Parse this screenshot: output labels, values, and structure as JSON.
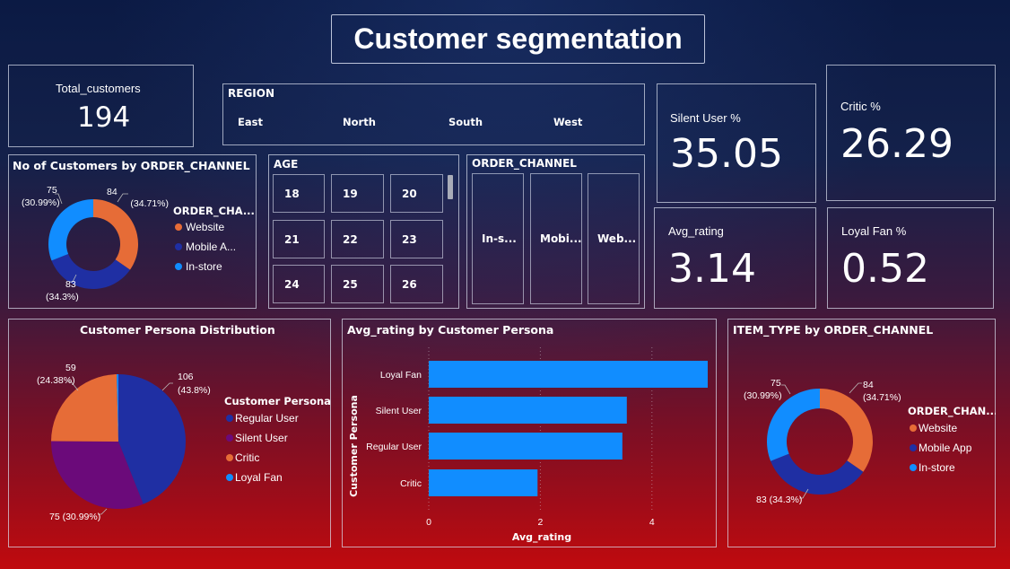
{
  "title": "Customer segmentation",
  "total_customers": {
    "label": "Total_customers",
    "value": "194"
  },
  "region": {
    "title": "REGION",
    "items": [
      "East",
      "North",
      "South",
      "West"
    ]
  },
  "silent_user": {
    "label": "Silent User %",
    "value": "35.05"
  },
  "critic": {
    "label": "Critic %",
    "value": "26.29"
  },
  "avg_rating_card": {
    "label": "Avg_rating",
    "value": "3.14"
  },
  "loyal_fan": {
    "label": "Loyal Fan %",
    "value": "0.52"
  },
  "age": {
    "title": "AGE",
    "items": [
      "18",
      "19",
      "20",
      "21",
      "22",
      "23",
      "24",
      "25",
      "26"
    ]
  },
  "order_channel_slicer": {
    "title": "ORDER_CHANNEL",
    "items": [
      "In-s...",
      "Mobi...",
      "Web..."
    ]
  },
  "donut1": {
    "title": "No of Customers by ORDER_CHANNEL",
    "legend_title": "ORDER_CHA...",
    "legend_items": [
      "Website",
      "Mobile A...",
      "In-store"
    ],
    "labels": [
      {
        "value": "84",
        "pct": "(34.71%)"
      },
      {
        "value": "83",
        "pct": "(34.3%)"
      },
      {
        "value": "75",
        "pct": "(30.99%)"
      }
    ]
  },
  "persona_pie": {
    "title": "Customer Persona Distribution",
    "legend_title": "Customer Persona",
    "legend_items": [
      "Regular User",
      "Silent User",
      "Critic",
      "Loyal Fan"
    ],
    "labels": [
      {
        "value": "106",
        "pct": "(43.8%)"
      },
      {
        "text": "75 (30.99%)"
      },
      {
        "value": "59",
        "pct": "(24.38%)"
      }
    ]
  },
  "bar_chart": {
    "title": "Avg_rating by Customer Persona",
    "xlabel": "Avg_rating",
    "ylabel": "Customer Persona",
    "categories": [
      "Loyal Fan",
      "Silent User",
      "Regular User",
      "Critic"
    ],
    "ticks": [
      "0",
      "2",
      "4"
    ]
  },
  "donut2": {
    "title": "ITEM_TYPE by ORDER_CHANNEL",
    "legend_title": "ORDER_CHAN...",
    "legend_items": [
      "Website",
      "Mobile App",
      "In-store"
    ],
    "labels": [
      {
        "value": "84",
        "pct": "(34.71%)"
      },
      {
        "text": "83 (34.3%)"
      },
      {
        "value": "75",
        "pct": "(30.99%)"
      }
    ]
  },
  "colors": {
    "website": "#e66c37",
    "mobile": "#1f2fa3",
    "instore": "#118dff",
    "silent": "#6b0a7a",
    "bar": "#118dff"
  },
  "chart_data": [
    {
      "type": "pie",
      "title": "No of Customers by ORDER_CHANNEL",
      "categories": [
        "Website",
        "Mobile App",
        "In-store"
      ],
      "values": [
        84,
        83,
        75
      ],
      "percent": [
        34.71,
        34.3,
        30.99
      ]
    },
    {
      "type": "pie",
      "title": "Customer Persona Distribution",
      "categories": [
        "Regular User",
        "Silent User",
        "Critic",
        "Loyal Fan"
      ],
      "values": [
        106,
        75,
        59,
        1
      ],
      "percent": [
        43.8,
        30.99,
        24.38,
        0.41
      ]
    },
    {
      "type": "bar",
      "title": "Avg_rating by Customer Persona",
      "categories": [
        "Loyal Fan",
        "Silent User",
        "Regular User",
        "Critic"
      ],
      "values": [
        5.0,
        3.55,
        3.47,
        1.95
      ],
      "xlabel": "Avg_rating",
      "ylabel": "Customer Persona",
      "xlim": [
        0,
        5
      ]
    },
    {
      "type": "pie",
      "title": "ITEM_TYPE by ORDER_CHANNEL",
      "categories": [
        "Website",
        "Mobile App",
        "In-store"
      ],
      "values": [
        84,
        83,
        75
      ],
      "percent": [
        34.71,
        34.3,
        30.99
      ]
    }
  ]
}
